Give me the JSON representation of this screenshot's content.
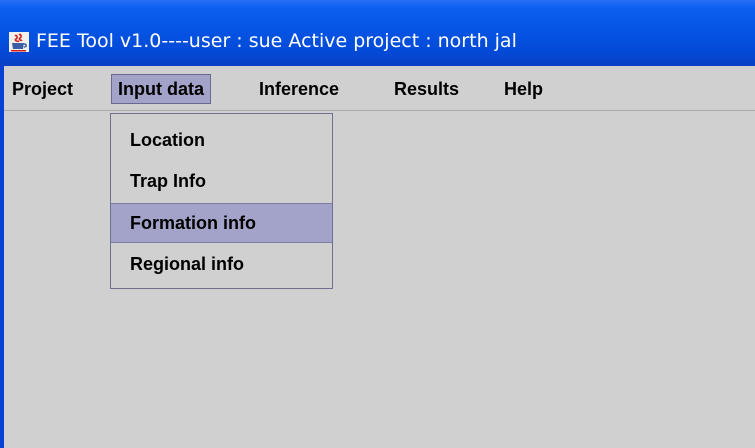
{
  "window": {
    "title": "FEE  Tool v1.0----user : sue Active project : north jal",
    "app_icon": "java-cup-icon"
  },
  "menubar": {
    "items": [
      {
        "label": "Project"
      },
      {
        "label": "Input data",
        "active": true
      },
      {
        "label": "Inference"
      },
      {
        "label": "Results"
      },
      {
        "label": "Help"
      }
    ]
  },
  "dropdown": {
    "items": [
      {
        "label": "Location"
      },
      {
        "label": "Trap Info"
      },
      {
        "label": "Formation info",
        "selected": true
      },
      {
        "label": "Regional info"
      }
    ]
  },
  "colors": {
    "titlebar": "#0553e3",
    "client_bg": "#d0d0d0",
    "highlight": "#a3a3c9"
  }
}
